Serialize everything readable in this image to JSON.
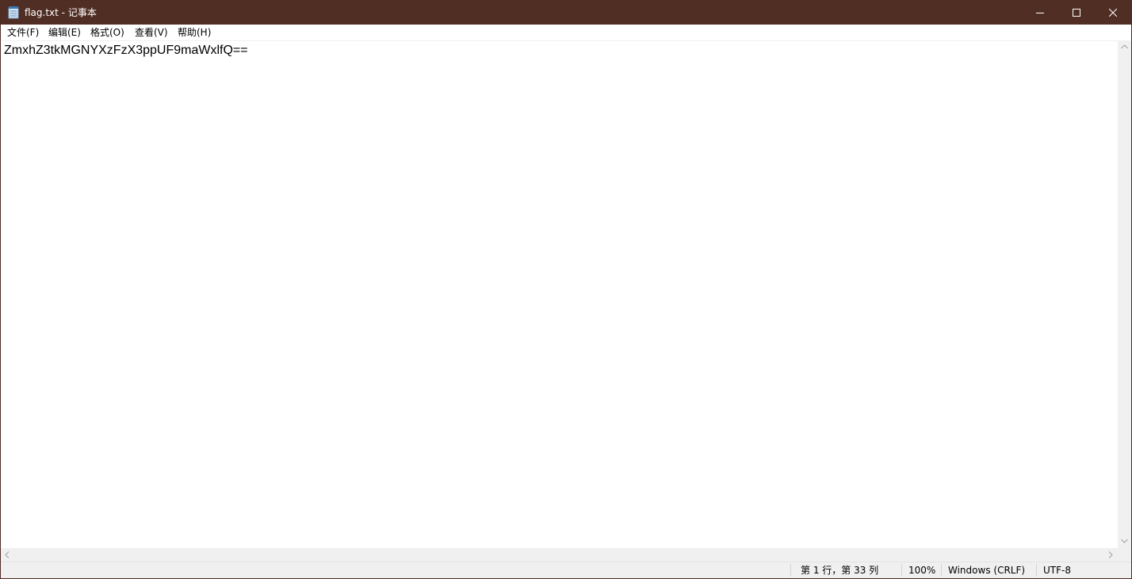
{
  "window": {
    "title": "flag.txt - 记事本",
    "icon": "notepad-icon",
    "controls": {
      "minimize": "minimize-icon",
      "maximize": "maximize-icon",
      "close": "close-icon"
    }
  },
  "menu": {
    "items": [
      {
        "label": "文件(F)"
      },
      {
        "label": "编辑(E)"
      },
      {
        "label": "格式(O)"
      },
      {
        "label": "查看(V)"
      },
      {
        "label": "帮助(H)"
      }
    ]
  },
  "editor": {
    "content": "ZmxhZ3tkMGNYXzFzX3ppUF9maWxlfQ=="
  },
  "statusbar": {
    "position": "第 1 行，第 33 列",
    "zoom": "100%",
    "line_ending": "Windows (CRLF)",
    "encoding": "UTF-8"
  },
  "colors": {
    "titlebar": "#512e24",
    "title_text": "#ffffff",
    "chrome": "#f0f0f0"
  }
}
